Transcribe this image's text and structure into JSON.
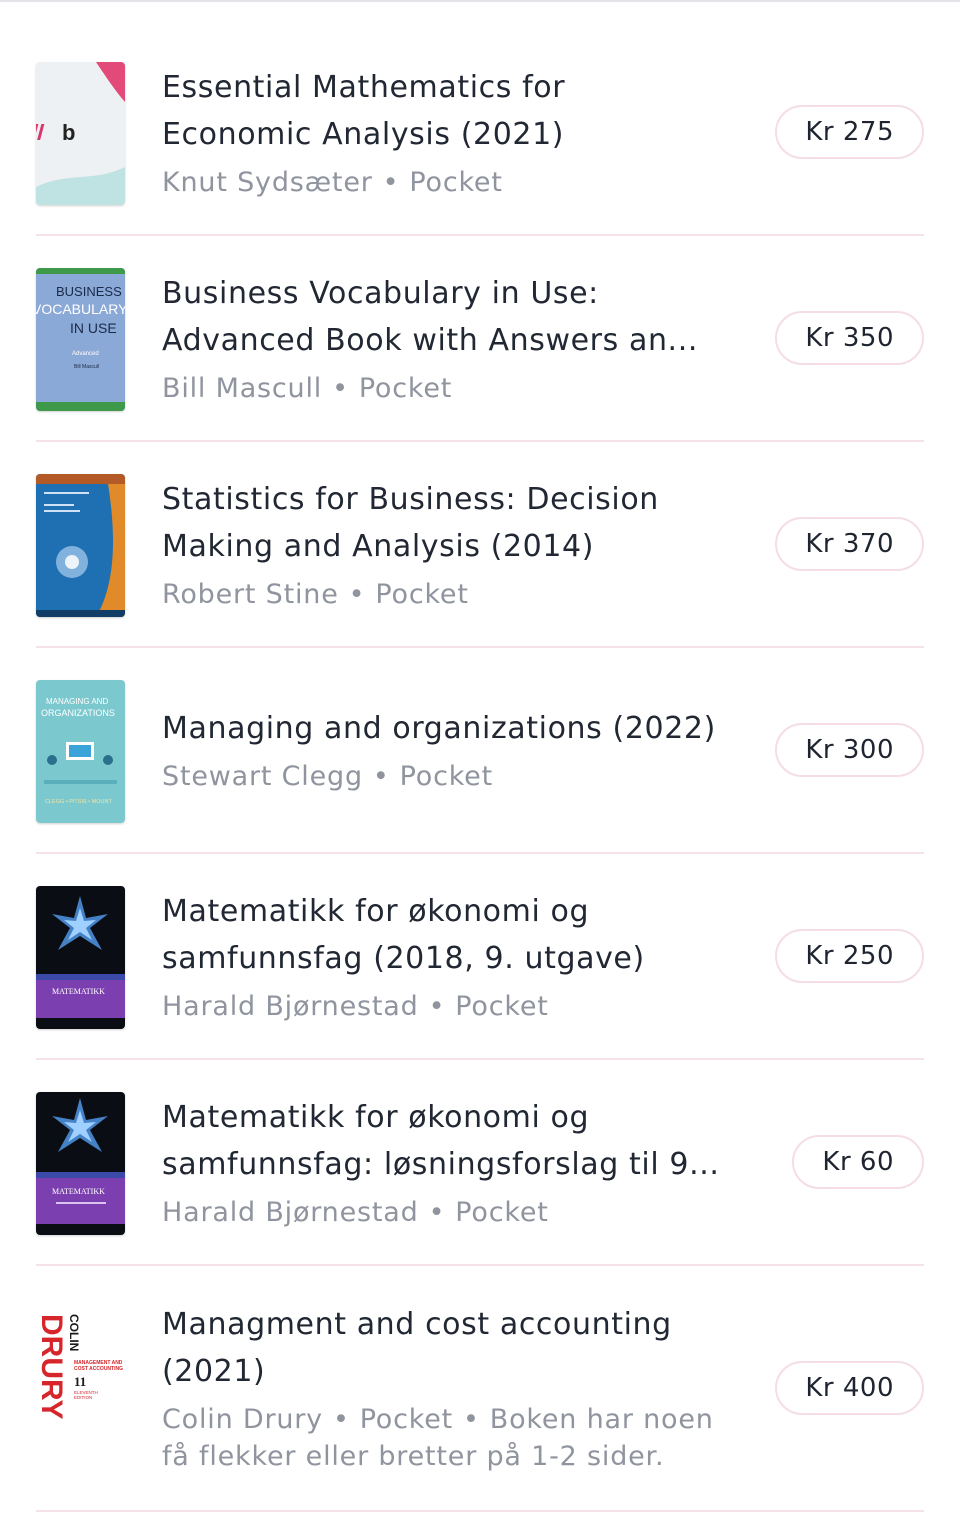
{
  "listings": [
    {
      "title_lines": [
        "Essential Mathematics for",
        "Economic Analysis (2021)"
      ],
      "author": "Knut Sydsæter",
      "format": "Pocket",
      "note": "",
      "price": "Kr 275",
      "cover_icon": "ilb-logo-cover"
    },
    {
      "title_lines": [
        "Business Vocabulary in Use:",
        "Advanced Book with Answers an..."
      ],
      "author": "Bill Mascull",
      "format": "Pocket",
      "note": "",
      "price": "Kr 350",
      "cover_icon": "business-vocabulary-cover",
      "cover_text": [
        "BUSINESS",
        "VOCABULARY",
        "IN USE",
        "Advanced",
        "Bill Mascull"
      ]
    },
    {
      "title_lines": [
        "Statistics for Business: Decision",
        "Making and Analysis (2014)"
      ],
      "author": "Robert Stine",
      "format": "Pocket",
      "note": "",
      "price": "Kr 370",
      "cover_icon": "statistics-cover"
    },
    {
      "title_lines": [
        "Managing and organizations (2022)"
      ],
      "author": "Stewart Clegg",
      "format": "Pocket",
      "note": "",
      "price": "Kr 300",
      "cover_icon": "managing-organizations-cover",
      "cover_text": [
        "MANAGING AND",
        "ORGANIZATIONS",
        "CLEGG • PITSIS • MOUNT"
      ]
    },
    {
      "title_lines": [
        "Matematikk for økonomi og",
        "samfunnsfag (2018, 9. utgave)"
      ],
      "author": "Harald Bjørnestad",
      "format": "Pocket",
      "note": "",
      "price": "Kr 250",
      "cover_icon": "matematikk-cover",
      "cover_text": [
        "MATEMATIKK"
      ]
    },
    {
      "title_lines": [
        "Matematikk for økonomi og",
        "samfunnsfag: løsningsforslag til 9..."
      ],
      "author": "Harald Bjørnestad",
      "format": "Pocket",
      "note": "",
      "price": "Kr 60",
      "cover_icon": "matematikk-losningsforslag-cover",
      "cover_text": [
        "MATEMATIKK"
      ]
    },
    {
      "title_lines": [
        "Managment and cost accounting",
        "(2021)"
      ],
      "author": "Colin Drury",
      "format": "Pocket",
      "note_lines": [
        "Boken har noen",
        "få flekker eller bretter på 1-2 sider."
      ],
      "price": "Kr 400",
      "cover_icon": "drury-cover",
      "cover_text": [
        "COLIN",
        "DRURY",
        "MANAGEMENT AND",
        "COST ACCOUNTING",
        "11",
        "ELEVENTH",
        "EDITION"
      ]
    }
  ],
  "separator": "•",
  "colors": {
    "divider": "#f7e1e8",
    "price_border": "#f5dde6",
    "meta_text": "#8f949e",
    "title_text": "#222833"
  }
}
